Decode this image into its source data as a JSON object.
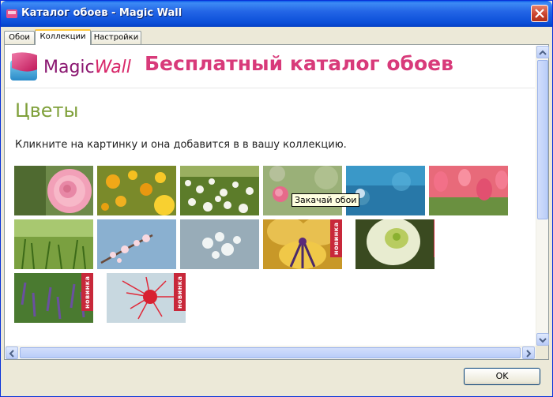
{
  "window": {
    "title": "Каталог обоев - Magic Wall"
  },
  "tabs": [
    {
      "label": "Обои",
      "active": false
    },
    {
      "label": "Коллекции",
      "active": true
    },
    {
      "label": "Настройки",
      "active": false
    }
  ],
  "header": {
    "logo_magic": "Magic",
    "logo_wall": "Wall",
    "title": "Бесплатный каталог обоев"
  },
  "section": {
    "title": "Цветы",
    "subtitle": "Кликните на картинку и она добавится в в вашу коллекцию."
  },
  "badge_label": "новинка",
  "tooltip": "Закачай обои",
  "thumbnails": [
    {
      "name": "pink-rose",
      "new": false
    },
    {
      "name": "yellow-poppies",
      "new": false
    },
    {
      "name": "white-daisies",
      "new": false
    },
    {
      "name": "pink-flower-bokeh",
      "new": false
    },
    {
      "name": "blue-flower",
      "new": false
    },
    {
      "name": "pink-tulips",
      "new": false
    },
    {
      "name": "green-grass",
      "new": false
    },
    {
      "name": "blossom-branch",
      "new": false
    },
    {
      "name": "white-blossoms",
      "new": false
    },
    {
      "name": "yellow-pansy",
      "new": true
    },
    {
      "name": "white-flower",
      "new": true
    },
    {
      "name": "lavender",
      "new": true
    },
    {
      "name": "red-bottlebrush",
      "new": true
    }
  ],
  "buttons": {
    "ok": "OK"
  },
  "colors": {
    "accent_pink": "#d83a7a",
    "section_green": "#7fa03a",
    "badge_red": "#c8283a"
  }
}
